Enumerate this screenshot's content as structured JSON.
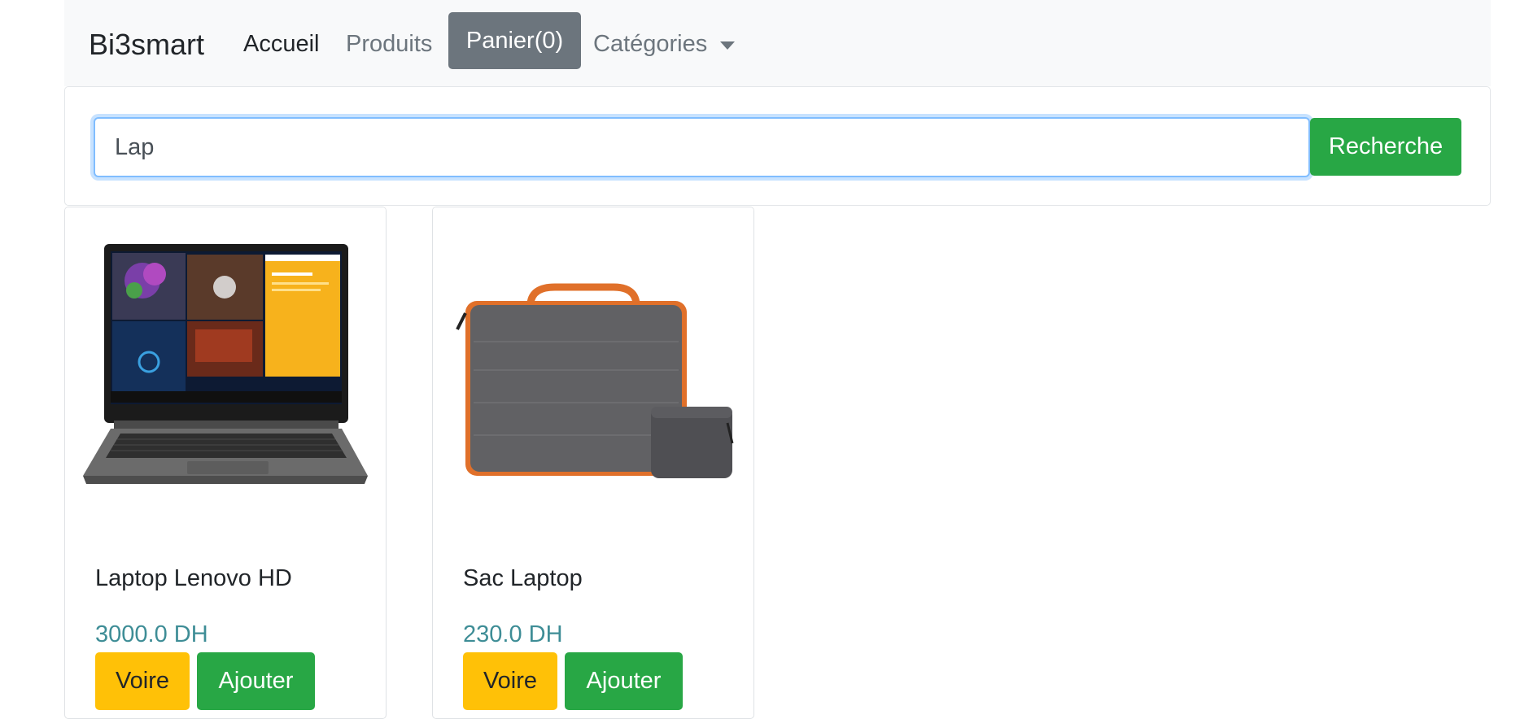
{
  "navbar": {
    "brand": "Bi3smart",
    "home_label": "Accueil",
    "products_label": "Produits",
    "cart_label": "Panier(0)",
    "categories_label": "Catégories",
    "categories_icon": "chevron-down-icon"
  },
  "search": {
    "value": "Lap",
    "button_label": "Recherche"
  },
  "products": [
    {
      "title": "Laptop Lenovo HD",
      "price": "3000.0 DH",
      "view_label": "Voire",
      "add_label": "Ajouter"
    },
    {
      "title": "Sac Laptop",
      "price": "230.0 DH",
      "view_label": "Voire",
      "add_label": "Ajouter"
    }
  ],
  "colors": {
    "navbar_bg": "#f8f9fa",
    "cart_button": "#6c757d",
    "success": "#28a745",
    "warning": "#ffc107",
    "price_text": "#3e8d96"
  }
}
